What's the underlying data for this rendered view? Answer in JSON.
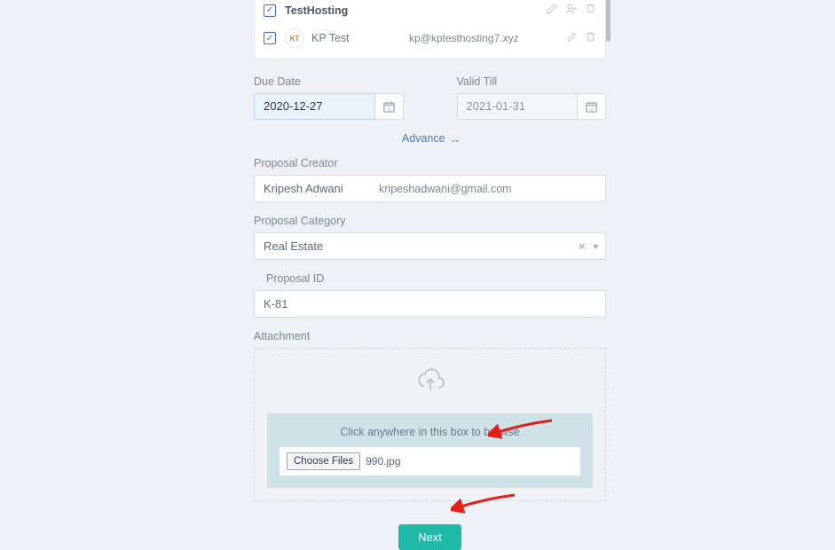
{
  "contacts": [
    {
      "name": "TestHosting",
      "email": "",
      "avatar": "",
      "bold": true
    },
    {
      "name": "KP Test",
      "email": "kp@kptesthosting7.xyz",
      "avatar": "KT"
    }
  ],
  "dueDate": {
    "label": "Due Date",
    "value": "2020-12-27"
  },
  "validTill": {
    "label": "Valid Till",
    "value": "2021-01-31"
  },
  "advance": "Advance",
  "proposalCreator": {
    "label": "Proposal Creator",
    "name": "Kripesh Adwani",
    "email": "kripeshadwani@gmail.com"
  },
  "proposalCategory": {
    "label": "Proposal Category",
    "value": "Real Estate"
  },
  "proposalId": {
    "label": "Proposal ID",
    "value": "K-81"
  },
  "attachment": {
    "label": "Attachment",
    "hint": "Click anywhere in this box to browse",
    "chooseLabel": "Choose Files",
    "fileName": "990.jpg"
  },
  "nextLabel": "Next"
}
